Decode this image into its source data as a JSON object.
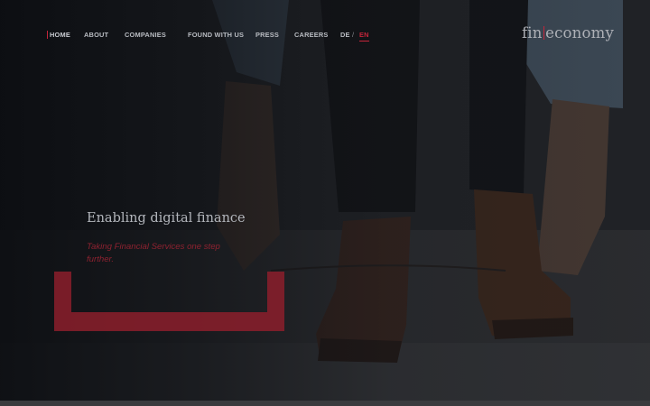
{
  "nav": {
    "items": [
      {
        "label": "HOME",
        "active": true
      },
      {
        "label": "ABOUT"
      },
      {
        "label": "COMPANIES"
      },
      {
        "label": "FOUND WITH US"
      },
      {
        "label": "PRESS"
      },
      {
        "label": "CAREERS"
      }
    ],
    "lang": {
      "de": "DE",
      "separator": "/",
      "en": "EN",
      "active": "EN"
    }
  },
  "logo": {
    "left": "fin",
    "right": "economy"
  },
  "hero": {
    "title": "Enabling digital finance",
    "subtitle": "Taking Financial Services one step further."
  },
  "colors": {
    "accent": "#c4253a",
    "background": "#15161a",
    "text": "#b3b6bc"
  }
}
